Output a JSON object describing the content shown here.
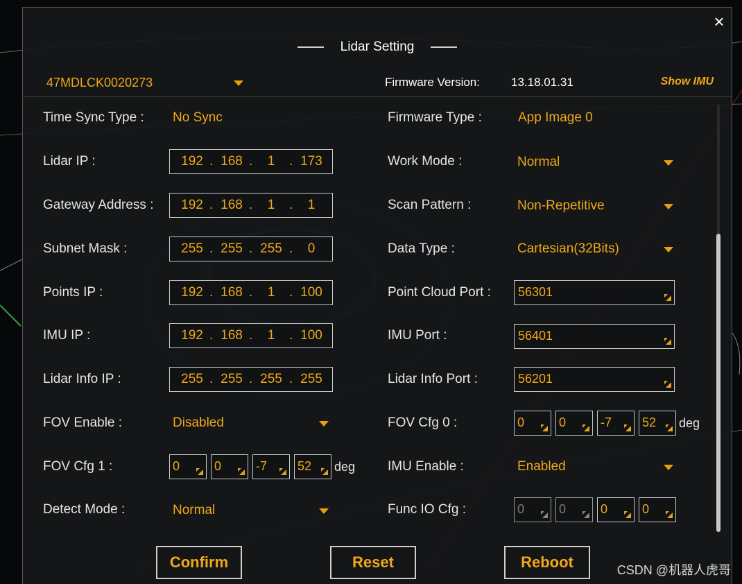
{
  "dialog": {
    "title": "Lidar Setting",
    "close_icon": "×"
  },
  "header": {
    "serial": "47MDLCK0020273",
    "firmware_label": "Firmware Version:",
    "firmware_value": "13.18.01.31",
    "show_imu": "Show IMU"
  },
  "left": {
    "time_sync": {
      "label": "Time Sync Type :",
      "value": "No Sync"
    },
    "lidar_ip": {
      "label": "Lidar IP :",
      "octets": [
        "192",
        "168",
        "1",
        "173"
      ]
    },
    "gateway": {
      "label": "Gateway Address :",
      "octets": [
        "192",
        "168",
        "1",
        "1"
      ]
    },
    "subnet": {
      "label": "Subnet Mask :",
      "octets": [
        "255",
        "255",
        "255",
        "0"
      ]
    },
    "points_ip": {
      "label": "Points IP :",
      "octets": [
        "192",
        "168",
        "1",
        "100"
      ]
    },
    "imu_ip": {
      "label": "IMU IP :",
      "octets": [
        "192",
        "168",
        "1",
        "100"
      ]
    },
    "lidar_info_ip": {
      "label": "Lidar Info IP :",
      "octets": [
        "255",
        "255",
        "255",
        "255"
      ]
    },
    "fov_enable": {
      "label": "FOV Enable :",
      "value": "Disabled"
    },
    "fov_cfg1": {
      "label": "FOV Cfg 1 :",
      "values": [
        "0",
        "0",
        "-7",
        "52"
      ],
      "unit": "deg"
    },
    "detect_mode": {
      "label": "Detect Mode :",
      "value": "Normal"
    }
  },
  "right": {
    "firmware_type": {
      "label": "Firmware Type :",
      "value": "App Image 0"
    },
    "work_mode": {
      "label": "Work Mode :",
      "value": "Normal"
    },
    "scan_pattern": {
      "label": "Scan Pattern :",
      "value": "Non-Repetitive"
    },
    "data_type": {
      "label": "Data Type :",
      "value": "Cartesian(32Bits)"
    },
    "point_cloud_port": {
      "label": "Point Cloud Port :",
      "value": "56301"
    },
    "imu_port": {
      "label": "IMU Port :",
      "value": "56401"
    },
    "lidar_info_port": {
      "label": "Lidar Info Port :",
      "value": "56201"
    },
    "fov_cfg0": {
      "label": "FOV Cfg 0 :",
      "values": [
        "0",
        "0",
        "-7",
        "52"
      ],
      "unit": "deg"
    },
    "imu_enable": {
      "label": "IMU Enable :",
      "value": "Enabled"
    },
    "func_io": {
      "label": "Func IO Cfg :",
      "values": [
        "0",
        "0",
        "0",
        "0"
      ]
    }
  },
  "buttons": {
    "confirm": "Confirm",
    "reset": "Reset",
    "reboot": "Reboot"
  },
  "watermark": "CSDN @机器人虎哥",
  "colors": {
    "accent": "#f0a818",
    "panel": "#16181a"
  }
}
